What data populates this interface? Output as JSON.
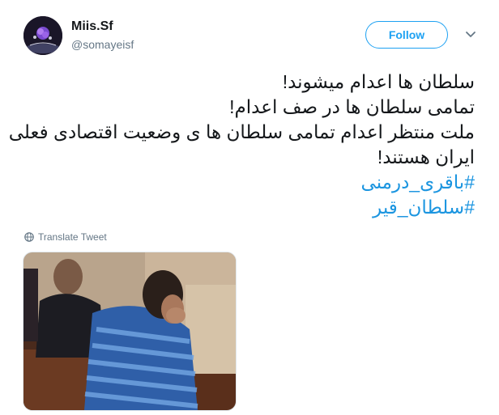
{
  "user": {
    "name": "Miis.Sf",
    "handle": "@somayeisf"
  },
  "header": {
    "follow_label": "Follow"
  },
  "tweet": {
    "lines": [
      "سلطان ها اعدام میشوند!",
      "تمامی سلطان ها در صف اعدام!",
      " ملت منتظر اعدام تمامی سلطان ها ی وضعیت اقتصادی فعلی",
      "ایران هستند!"
    ],
    "hashtags": [
      "#باقری_درمنی",
      "#سلطان_قیر"
    ]
  },
  "translate_label": "Translate Tweet",
  "colors": {
    "accent": "#1da1f2",
    "hashtag": "#1b95e0",
    "secondary_text": "#657786",
    "border": "#e1e8ed"
  },
  "icons": {
    "caret": "chevron-down-icon",
    "translate": "globe-icon"
  }
}
